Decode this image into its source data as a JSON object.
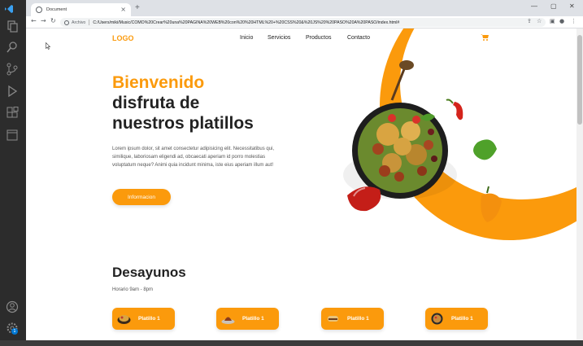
{
  "browser": {
    "tab_title": "Document",
    "tab_close": "×",
    "new_tab": "+",
    "window_controls": [
      "—",
      "▢",
      "✕"
    ],
    "omnibox_label": "Archivo",
    "url": "C:/Users/miki/Music/COMO%20Crear%20una%20PAGINA%20WEB%20con%20%20HTML%20+%20CSS%20&%20JS%20%20PASO%20A%20PASO/index.html#",
    "nav": {
      "back": "←",
      "forward": "→",
      "reload": "↻"
    }
  },
  "site": {
    "logo": "LOGO",
    "menu": [
      "Inicio",
      "Servicios",
      "Productos",
      "Contacto"
    ],
    "hero": {
      "title_orange": "Bienvenido",
      "title_line2": "disfruta de",
      "title_line3": "nuestros platillos",
      "lorem": "Lorem ipsum dolor, sit amet consectetur adipisicing elit. Necessitatibus qui, similique, laboriosam eligendi ad, obcaecati aperiam id porro molestias voluptatum neque? Animi quia incidunt minima, iste eius aperiam illum aut!",
      "button": "Informacion"
    },
    "desayunos": {
      "title": "Desayunos",
      "horario": "Horario 9am - 8pm",
      "platos": [
        "Platillo 1",
        "Platillo 1",
        "Platillo 1",
        "Platillo 1"
      ]
    }
  },
  "colors": {
    "accent": "#fb9a0c",
    "dark_text": "#222222",
    "vscode_bar": "#2c2c2c"
  },
  "icons": [
    "vscode-logo-icon",
    "explorer-icon",
    "search-icon",
    "source-control-icon",
    "run-debug-icon",
    "extensions-icon",
    "remote-icon",
    "account-icon",
    "settings-gear-icon",
    "cart-icon",
    "bookmark-star-icon",
    "share-icon",
    "profile-icon",
    "kebab-menu-icon"
  ],
  "statusbar": {
    "badge_count": "1"
  }
}
